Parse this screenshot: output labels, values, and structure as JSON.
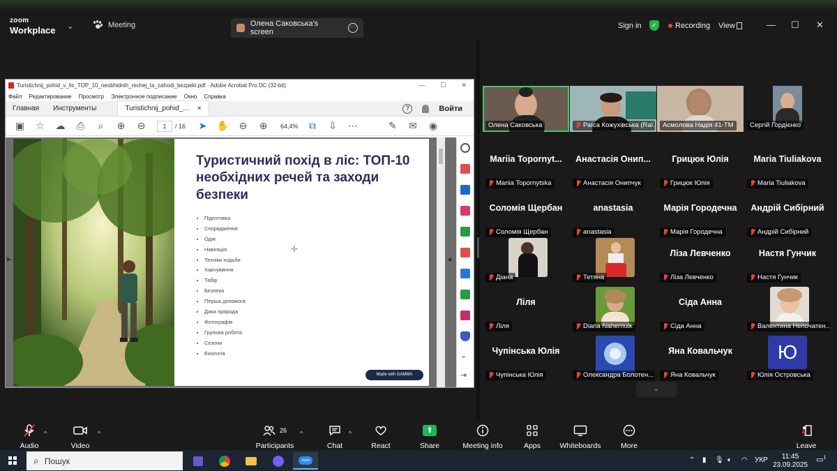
{
  "zoom_header": {
    "brand_line1": "zoom",
    "brand_line2": "Workplace",
    "meeting_tab": "Meeting",
    "screen_tab": "Олена Саковська's screen",
    "sign_in": "Sign in",
    "recording": "Recording",
    "view": "View",
    "colors": {
      "recording_dot": "#e8413c",
      "secure_shield": "#2bb24c"
    }
  },
  "acrobat": {
    "title": "Turistichnij_pohid_v_lis_TOP_10_neobhidnih_rechej_ta_zahodi_bezpeki.pdf - Adobe Acrobat Pro DC (32-bit)",
    "menu": [
      "Файл",
      "Редактирование",
      "Просмотр",
      "Электронное подписание",
      "Окно",
      "Справка"
    ],
    "tabs": {
      "home": "Главная",
      "tools": "Инструменты",
      "doc": "Turistichnij_pohid_...",
      "close": "×",
      "signin": "Войти"
    },
    "toolbar": {
      "page_current": "1",
      "page_total": "/ 16",
      "zoom": "64,4%"
    }
  },
  "slide": {
    "title": "Туристичний похід в ліс: ТОП-10 необхідних речей та заходи безпеки",
    "bullets": [
      "Підготовка",
      "Спорядження",
      "Одяг",
      "Навігація",
      "Техніки ходьби",
      "Харчування",
      "Табір",
      "Безпека",
      "Перша допомога",
      "Дика природа",
      "Фотографія",
      "Групова робота",
      "Сезони",
      "Екологія"
    ],
    "badge": "Made with GAMMA",
    "colors": {
      "title": "#2d2b5d"
    }
  },
  "gallery": {
    "tiles": [
      {
        "big": "",
        "label": "Олена Саковська",
        "muted": false
      },
      {
        "big": "",
        "label": "Раїса Кожухівська (Raї...",
        "muted": true
      },
      {
        "big": "",
        "label": "Асмолова Надія 41-ТМ",
        "muted": false
      },
      {
        "big": "",
        "label": "Сергій Гордієнко",
        "muted": false
      },
      {
        "big": "Mariia Topornyt...",
        "label": "Mariia Topornytska",
        "muted": true
      },
      {
        "big": "Анастасія Онип...",
        "label": "Анастасія Онипчук",
        "muted": true
      },
      {
        "big": "Грицюк Юлія",
        "label": "Грицюк Юлія",
        "muted": true
      },
      {
        "big": "Maria Tiuliakova",
        "label": "Maria Tiuliakova",
        "muted": true
      },
      {
        "big": "Соломія Щербан",
        "label": "Соломія Щербан",
        "muted": true
      },
      {
        "big": "anastasia",
        "label": "anastasia",
        "muted": true
      },
      {
        "big": "Марія Городечна",
        "label": "Марія Городечна",
        "muted": true
      },
      {
        "big": "Андрій Сибірний",
        "label": "Андрій Сибірний",
        "muted": true
      },
      {
        "big": "",
        "label": "Діана",
        "muted": true
      },
      {
        "big": "",
        "label": "Тетяна",
        "muted": true
      },
      {
        "big": "Ліза Левченко",
        "label": "Ліза Левченко",
        "muted": true
      },
      {
        "big": "Настя Гунчик",
        "label": "Настя Гунчик",
        "muted": true
      },
      {
        "big": "Ліля",
        "label": "Ліля",
        "muted": true
      },
      {
        "big": "",
        "label": "Diana Nahernuik",
        "muted": true
      },
      {
        "big": "Сіда Анна",
        "label": "Сіда Анна",
        "muted": true
      },
      {
        "big": "",
        "label": "Валентина Непочатен...",
        "muted": true
      },
      {
        "big": "Чупінська Юлія",
        "label": "Чупінська Юлія",
        "muted": true
      },
      {
        "big": "",
        "label": "Олександра Болотен...",
        "muted": true
      },
      {
        "big": "Яна Ковальчук",
        "label": "Яна Ковальчук",
        "muted": true
      },
      {
        "big": "",
        "label": "Юлія Островська",
        "muted": true
      }
    ],
    "avatar_letter": "Ю"
  },
  "toolbar": {
    "audio": "Audio",
    "video": "Video",
    "participants": "Participants",
    "participants_count": "26",
    "chat": "Chat",
    "react": "React",
    "share": "Share",
    "meeting_info": "Meeting info",
    "apps": "Apps",
    "whiteboards": "Whiteboards",
    "more": "More",
    "leave": "Leave"
  },
  "taskbar": {
    "search": "Пошук",
    "language": "УКР",
    "time": "11:45",
    "date": "23.09.2025",
    "notification_count": "1"
  }
}
